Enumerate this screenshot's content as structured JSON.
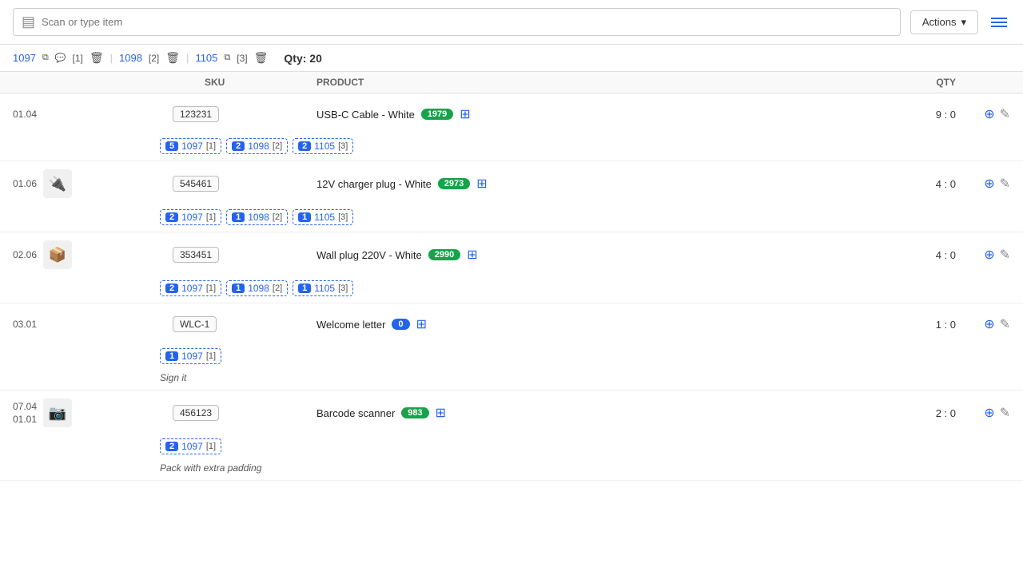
{
  "topbar": {
    "scan_placeholder": "Scan or type item",
    "actions_label": "Actions",
    "qty_label": "Qty:",
    "qty_value": "20"
  },
  "tabs": [
    {
      "id": "1097",
      "icon": "copy",
      "comment_icon": true,
      "comment_count": 1,
      "has_delete": true
    },
    {
      "id": "1098",
      "icon": "copy",
      "count": 2,
      "has_delete": true
    },
    {
      "id": "1105",
      "icon": "copy",
      "count": 3,
      "has_delete": true
    }
  ],
  "columns": {
    "sku": "SKU",
    "product": "Product",
    "qty": "Qty"
  },
  "rows": [
    {
      "location": "01.04",
      "image": null,
      "sku": "123231",
      "product_name": "USB-C Cable - White",
      "tag_value": "1979",
      "tag_color": "green",
      "qty": "9 : 0",
      "tags": [
        {
          "num": 5,
          "order": "1097",
          "count": 1
        },
        {
          "num": 2,
          "order": "1098",
          "count": 2
        },
        {
          "num": 2,
          "order": "1105",
          "count": 3
        }
      ],
      "note": null
    },
    {
      "location": "01.06",
      "image": "plug",
      "sku": "545461",
      "product_name": "12V charger plug - White",
      "tag_value": "2973",
      "tag_color": "green",
      "qty": "4 : 0",
      "tags": [
        {
          "num": 2,
          "order": "1097",
          "count": 1
        },
        {
          "num": 1,
          "order": "1098",
          "count": 2
        },
        {
          "num": 1,
          "order": "1105",
          "count": 3
        }
      ],
      "note": null
    },
    {
      "location": "02.06",
      "image": "box",
      "sku": "353451",
      "product_name": "Wall plug 220V - White",
      "tag_value": "2990",
      "tag_color": "green",
      "qty": "4 : 0",
      "tags": [
        {
          "num": 2,
          "order": "1097",
          "count": 1
        },
        {
          "num": 1,
          "order": "1098",
          "count": 2
        },
        {
          "num": 1,
          "order": "1105",
          "count": 3
        }
      ],
      "note": null
    },
    {
      "location": "03.01",
      "image": null,
      "sku": "WLC-1",
      "product_name": "Welcome letter",
      "tag_value": "0",
      "tag_color": "blue",
      "qty": "1 : 0",
      "tags": [
        {
          "num": 1,
          "order": "1097",
          "count": 1
        }
      ],
      "note": "Sign it"
    },
    {
      "location": "07.04\n01.01",
      "image": "scanner",
      "sku": "456123",
      "product_name": "Barcode scanner",
      "tag_value": "983",
      "tag_color": "green",
      "qty": "2 : 0",
      "tags": [
        {
          "num": 2,
          "order": "1097",
          "count": 1
        }
      ],
      "note": "Pack with extra padding"
    }
  ],
  "icons": {
    "barcode": "▤",
    "copy": "⧉",
    "comment": "💬",
    "trash": "🗑",
    "add": "⊕",
    "edit": "✎",
    "expand": "⊞",
    "menu": "☰"
  }
}
